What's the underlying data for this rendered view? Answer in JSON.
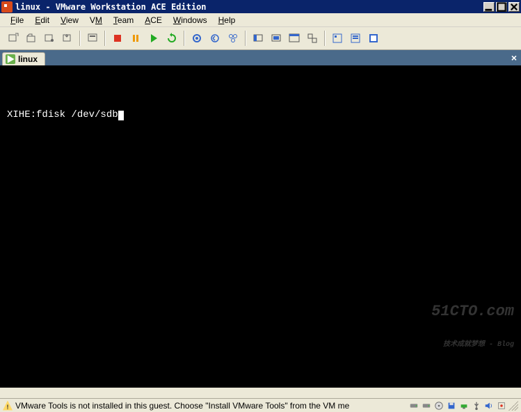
{
  "titlebar": {
    "text": "linux - VMware Workstation ACE Edition"
  },
  "menu": {
    "file": "File",
    "edit": "Edit",
    "view": "View",
    "vm": "VM",
    "team": "Team",
    "ace": "ACE",
    "windows": "Windows",
    "help": "Help"
  },
  "toolbar": {
    "power_off": "power-off",
    "suspend": "suspend",
    "power_on": "power-on",
    "reset": "reset",
    "snapshot": "snapshot",
    "revert": "revert",
    "snapshot_manager": "snapshot-manager",
    "show_console": "show-console",
    "quick_switch": "quick-switch",
    "full_screen": "full-screen",
    "unity": "unity",
    "summary": "summary",
    "appliance": "appliance",
    "console": "console"
  },
  "tab": {
    "label": "linux"
  },
  "terminal": {
    "prompt": "XIHE:",
    "command": "fdisk /dev/sdb"
  },
  "statusbar": {
    "message": "VMware Tools is not installed in this guest. Choose \"Install VMware Tools\" from the VM me"
  },
  "watermark": {
    "brand": "51CTO.com",
    "tagline": "技术成就梦想 - Blog"
  },
  "tray": {
    "icons": [
      "hdd",
      "cd",
      "floppy",
      "net1",
      "net2",
      "usb",
      "sound",
      "tools"
    ]
  }
}
